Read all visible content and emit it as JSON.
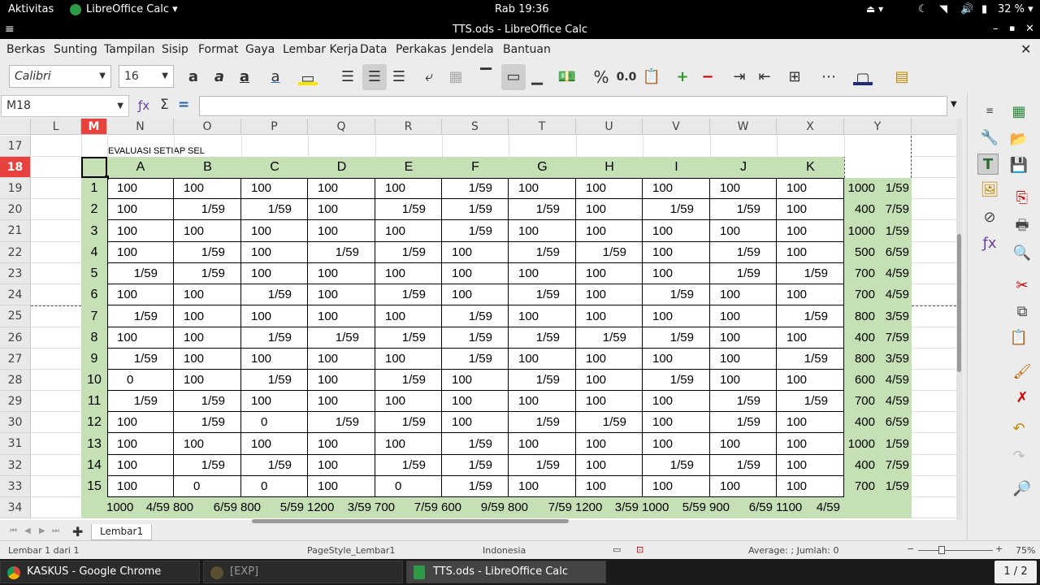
{
  "system": {
    "activities": "Aktivitas",
    "app_menu": "LibreOffice Calc",
    "clock": "Rab 19:36",
    "battery": "32 %"
  },
  "window": {
    "title": "TTS.ods - LibreOffice Calc"
  },
  "menu": [
    "Berkas",
    "Sunting",
    "Tampilan",
    "Sisip",
    "Format",
    "Gaya",
    "Lembar Kerja",
    "Data",
    "Perkakas",
    "Jendela",
    "Bantuan"
  ],
  "toolbar": {
    "font_name": "Calibri",
    "font_size": "16",
    "percent_label": "%",
    "decimal_label": "0.0"
  },
  "formula": {
    "name_box": "M18",
    "content": ""
  },
  "columns": [
    "L",
    "M",
    "N",
    "O",
    "P",
    "Q",
    "R",
    "S",
    "T",
    "U",
    "V",
    "W",
    "X",
    "Y"
  ],
  "rows": [
    "17",
    "18",
    "19",
    "20",
    "21",
    "22",
    "23",
    "24",
    "25",
    "26",
    "27",
    "28",
    "29",
    "30",
    "31",
    "32",
    "33",
    "34"
  ],
  "sheet": {
    "title_text": "EVALUASI SETIAP SEL",
    "header_letters": [
      "A",
      "B",
      "C",
      "D",
      "E",
      "F",
      "G",
      "H",
      "I",
      "J",
      "K"
    ],
    "data": [
      [
        "1",
        "100",
        "100",
        "100",
        "100",
        "100",
        "1/59",
        "100",
        "100",
        "100",
        "100",
        "100",
        "1000",
        "1/59"
      ],
      [
        "2",
        "100",
        "1/59",
        "1/59",
        "100",
        "1/59",
        "1/59",
        "1/59",
        "100",
        "1/59",
        "1/59",
        "100",
        "400",
        "7/59"
      ],
      [
        "3",
        "100",
        "100",
        "100",
        "100",
        "100",
        "1/59",
        "100",
        "100",
        "100",
        "100",
        "100",
        "1000",
        "1/59"
      ],
      [
        "4",
        "100",
        "1/59",
        "100",
        "1/59",
        "1/59",
        "100",
        "1/59",
        "1/59",
        "100",
        "1/59",
        "100",
        "500",
        "6/59"
      ],
      [
        "5",
        "1/59",
        "1/59",
        "100",
        "100",
        "100",
        "100",
        "100",
        "100",
        "100",
        "1/59",
        "1/59",
        "700",
        "4/59"
      ],
      [
        "6",
        "100",
        "100",
        "1/59",
        "100",
        "1/59",
        "100",
        "1/59",
        "100",
        "1/59",
        "100",
        "100",
        "700",
        "4/59"
      ],
      [
        "7",
        "1/59",
        "100",
        "100",
        "100",
        "100",
        "1/59",
        "100",
        "100",
        "100",
        "100",
        "1/59",
        "800",
        "3/59"
      ],
      [
        "8",
        "100",
        "100",
        "1/59",
        "1/59",
        "1/59",
        "1/59",
        "1/59",
        "1/59",
        "1/59",
        "100",
        "100",
        "400",
        "7/59"
      ],
      [
        "9",
        "1/59",
        "100",
        "100",
        "100",
        "100",
        "1/59",
        "100",
        "100",
        "100",
        "100",
        "1/59",
        "800",
        "3/59"
      ],
      [
        "10",
        "0",
        "100",
        "1/59",
        "100",
        "1/59",
        "100",
        "1/59",
        "100",
        "1/59",
        "100",
        "100",
        "600",
        "4/59"
      ],
      [
        "11",
        "1/59",
        "1/59",
        "100",
        "100",
        "100",
        "100",
        "100",
        "100",
        "100",
        "1/59",
        "1/59",
        "700",
        "4/59"
      ],
      [
        "12",
        "100",
        "1/59",
        "0",
        "1/59",
        "1/59",
        "100",
        "1/59",
        "1/59",
        "100",
        "1/59",
        "100",
        "400",
        "6/59"
      ],
      [
        "13",
        "100",
        "100",
        "100",
        "100",
        "100",
        "1/59",
        "100",
        "100",
        "100",
        "100",
        "100",
        "1000",
        "1/59"
      ],
      [
        "14",
        "100",
        "1/59",
        "1/59",
        "100",
        "1/59",
        "1/59",
        "1/59",
        "100",
        "1/59",
        "1/59",
        "100",
        "400",
        "7/59"
      ],
      [
        "15",
        "100",
        "0",
        "0",
        "100",
        "0",
        "1/59",
        "100",
        "100",
        "100",
        "100",
        "100",
        "700",
        "1/59"
      ]
    ],
    "totals": [
      [
        "1000",
        "4/59"
      ],
      [
        "800",
        "6/59"
      ],
      [
        "800",
        "5/59"
      ],
      [
        "1200",
        "3/59"
      ],
      [
        "700",
        "7/59"
      ],
      [
        "600",
        "9/59"
      ],
      [
        "800",
        "7/59"
      ],
      [
        "1200",
        "3/59"
      ],
      [
        "1000",
        "5/59"
      ],
      [
        "900",
        "6/59"
      ],
      [
        "1100",
        "4/59"
      ]
    ]
  },
  "sheet_tab": "Lembar1",
  "status": {
    "page": "Lembar 1 dari 1",
    "page_style": "PageStyle_Lembar1",
    "language": "Indonesia",
    "summary": "Average: ; Jumlah: 0",
    "zoom": "75%"
  },
  "taskbar": {
    "items": [
      "KASKUS - Google Chrome",
      "[EXP]",
      "TTS.ods - LibreOffice Calc"
    ],
    "workspace": "1 / 2"
  },
  "colors": {
    "header_green": "#c5e0b4",
    "active_header": "#e8423f"
  }
}
